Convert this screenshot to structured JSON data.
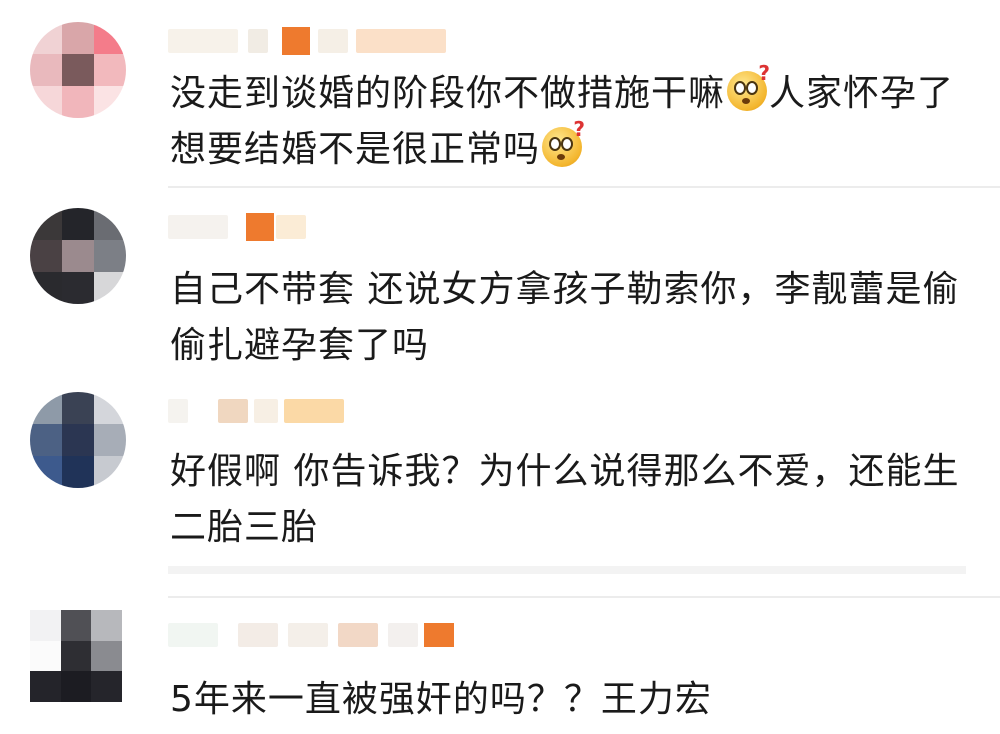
{
  "comments": [
    {
      "text_a": "没走到谈婚的阶段你不做措施干嘛",
      "emoji": "doubt-face-emoji",
      "text_b": "人家怀孕了想要结婚不是很正常吗"
    },
    {
      "text": "自己不带套 还说女方拿孩子勒索你，李靓蕾是偷偷扎避孕套了吗"
    },
    {
      "text": "好假啊 你告诉我？为什么说得那么不爱，还能生二胎三胎"
    },
    {
      "text": "5年来一直被强奸的吗？？王力宏"
    }
  ],
  "colors": {
    "text": "#1a1a1a",
    "divider": "#ececec",
    "badge_orange": "#ee7a2e"
  }
}
